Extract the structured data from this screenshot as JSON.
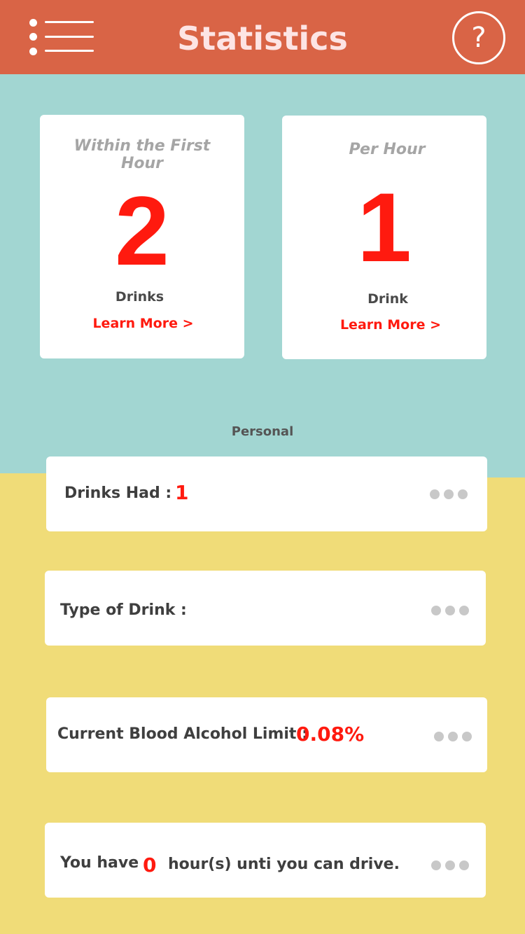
{
  "header": {
    "title": "Statistics",
    "help_glyph": "?",
    "menu_icon": "hamburger-menu-icon",
    "help_icon": "question-circle-icon"
  },
  "cards": [
    {
      "subtitle": "Within the First Hour",
      "value": "2",
      "unit": "Drinks",
      "link": "Learn More >"
    },
    {
      "subtitle": "Per Hour",
      "value": "1",
      "unit": "Drink",
      "link": "Learn More >"
    }
  ],
  "personal": {
    "label": "Personal",
    "rows": [
      {
        "label": "Drinks Had :",
        "value": "1"
      },
      {
        "label": "Type of Drink :",
        "value": ""
      },
      {
        "label": "Current Blood Alcohol Limit :",
        "value": "0.08%"
      },
      {
        "label_before": "You have",
        "value": "0",
        "label_after": "hour(s) unti you can drive."
      }
    ]
  },
  "colors": {
    "header": "#d96446",
    "teal": "#a2d6d2",
    "yellow": "#f0dc78",
    "accent_red": "#ff1a0f"
  }
}
